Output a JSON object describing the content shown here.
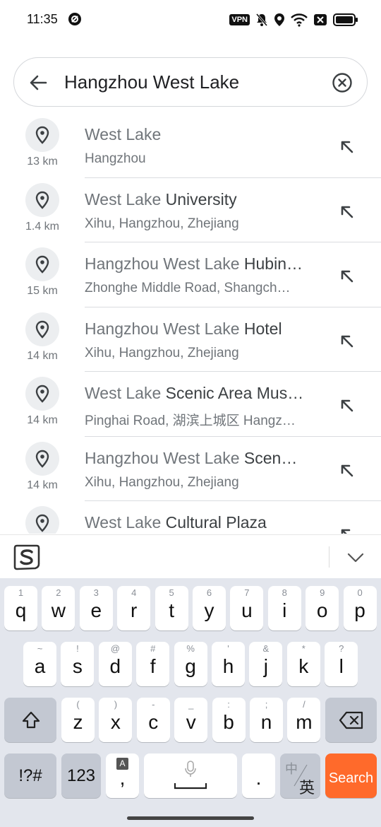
{
  "status_bar": {
    "time": "11:35",
    "vpn_label": "VPN",
    "icons": [
      "notification-app-icon",
      "vpn-icon",
      "mute-bell-icon",
      "location-icon",
      "wifi-icon",
      "sim-x-icon",
      "battery-icon"
    ]
  },
  "search": {
    "query": "Hangzhou West Lake",
    "icons": [
      "back-arrow-icon",
      "clear-circle-x-icon"
    ]
  },
  "results": [
    {
      "match": "West Lake",
      "rest": "",
      "subtitle": "Hangzhou",
      "distance": "13 km"
    },
    {
      "match": "West Lake",
      "rest": " University",
      "subtitle": "Xihu, Hangzhou, Zhejiang",
      "distance": "1.4 km"
    },
    {
      "match": "Hangzhou West Lake",
      "rest": " Hubin…",
      "subtitle": "Zhonghe Middle Road, Shangch…",
      "distance": "15 km"
    },
    {
      "match": "Hangzhou West Lake",
      "rest": " Hotel",
      "subtitle": "Xihu, Hangzhou, Zhejiang",
      "distance": "14 km"
    },
    {
      "match": "West Lake",
      "rest": " Scenic Area Mus…",
      "subtitle": "Pinghai Road, 湖滨上城区 Hangz…",
      "distance": "14 km"
    },
    {
      "match": "Hangzhou West Lake",
      "rest": " Scen…",
      "subtitle": "Xihu, Hangzhou, Zhejiang",
      "distance": "14 km"
    },
    {
      "match": "West Lake",
      "rest": " Cultural Plaza",
      "subtitle": "",
      "distance": ""
    }
  ],
  "keyboard": {
    "toolbar_icons": [
      "sogou-logo-icon",
      "collapse-chevron-icon"
    ],
    "row1": [
      {
        "label": "q",
        "hint": "1"
      },
      {
        "label": "w",
        "hint": "2"
      },
      {
        "label": "e",
        "hint": "3"
      },
      {
        "label": "r",
        "hint": "4"
      },
      {
        "label": "t",
        "hint": "5"
      },
      {
        "label": "y",
        "hint": "6"
      },
      {
        "label": "u",
        "hint": "7"
      },
      {
        "label": "i",
        "hint": "8"
      },
      {
        "label": "o",
        "hint": "9"
      },
      {
        "label": "p",
        "hint": "0"
      }
    ],
    "row2": [
      {
        "label": "a",
        "hint": "~"
      },
      {
        "label": "s",
        "hint": "!"
      },
      {
        "label": "d",
        "hint": "@"
      },
      {
        "label": "f",
        "hint": "#"
      },
      {
        "label": "g",
        "hint": "%"
      },
      {
        "label": "h",
        "hint": "'"
      },
      {
        "label": "j",
        "hint": "&"
      },
      {
        "label": "k",
        "hint": "*"
      },
      {
        "label": "l",
        "hint": "?"
      }
    ],
    "row3": [
      {
        "label": "z",
        "hint": "("
      },
      {
        "label": "x",
        "hint": ")"
      },
      {
        "label": "c",
        "hint": "-"
      },
      {
        "label": "v",
        "hint": "_"
      },
      {
        "label": "b",
        "hint": ":"
      },
      {
        "label": "n",
        "hint": ";"
      },
      {
        "label": "m",
        "hint": "/"
      }
    ],
    "symbols_label": "!?#",
    "numbers_label": "123",
    "comma_label": ",",
    "comma_hint": "A",
    "period_label": ".",
    "lang_top": "中",
    "lang_bottom": "英",
    "search_label": "Search",
    "accent_color": "#ff6a2b"
  }
}
